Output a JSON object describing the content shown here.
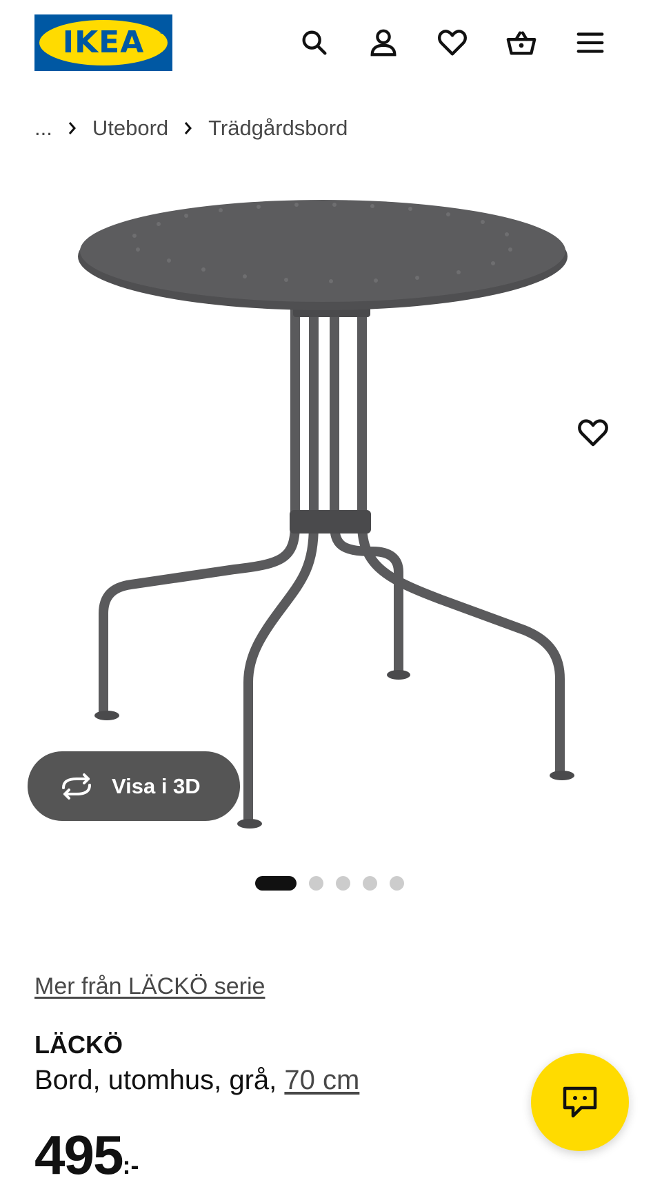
{
  "header": {
    "logo_text": "IKEA",
    "logo_mark": "®",
    "icons": [
      "search-icon",
      "account-icon",
      "heart-icon",
      "basket-icon",
      "menu-icon"
    ]
  },
  "breadcrumb": {
    "ellipsis": "...",
    "items": [
      "Utebord",
      "Trädgårdsbord"
    ]
  },
  "gallery": {
    "view3d_label": "Visa i 3D",
    "image_count": 5,
    "active_index": 0
  },
  "product": {
    "series_link": "Mer från LÄCKÖ serie",
    "name": "LÄCKÖ",
    "description": "Bord, utomhus, grå, ",
    "size": "70 cm",
    "price": "495",
    "price_suffix": ":-"
  },
  "colors": {
    "brand_blue": "#0058a3",
    "brand_yellow": "#ffdb00",
    "table_grey": "#5a5a5c",
    "view3d_bg": "#555555"
  }
}
